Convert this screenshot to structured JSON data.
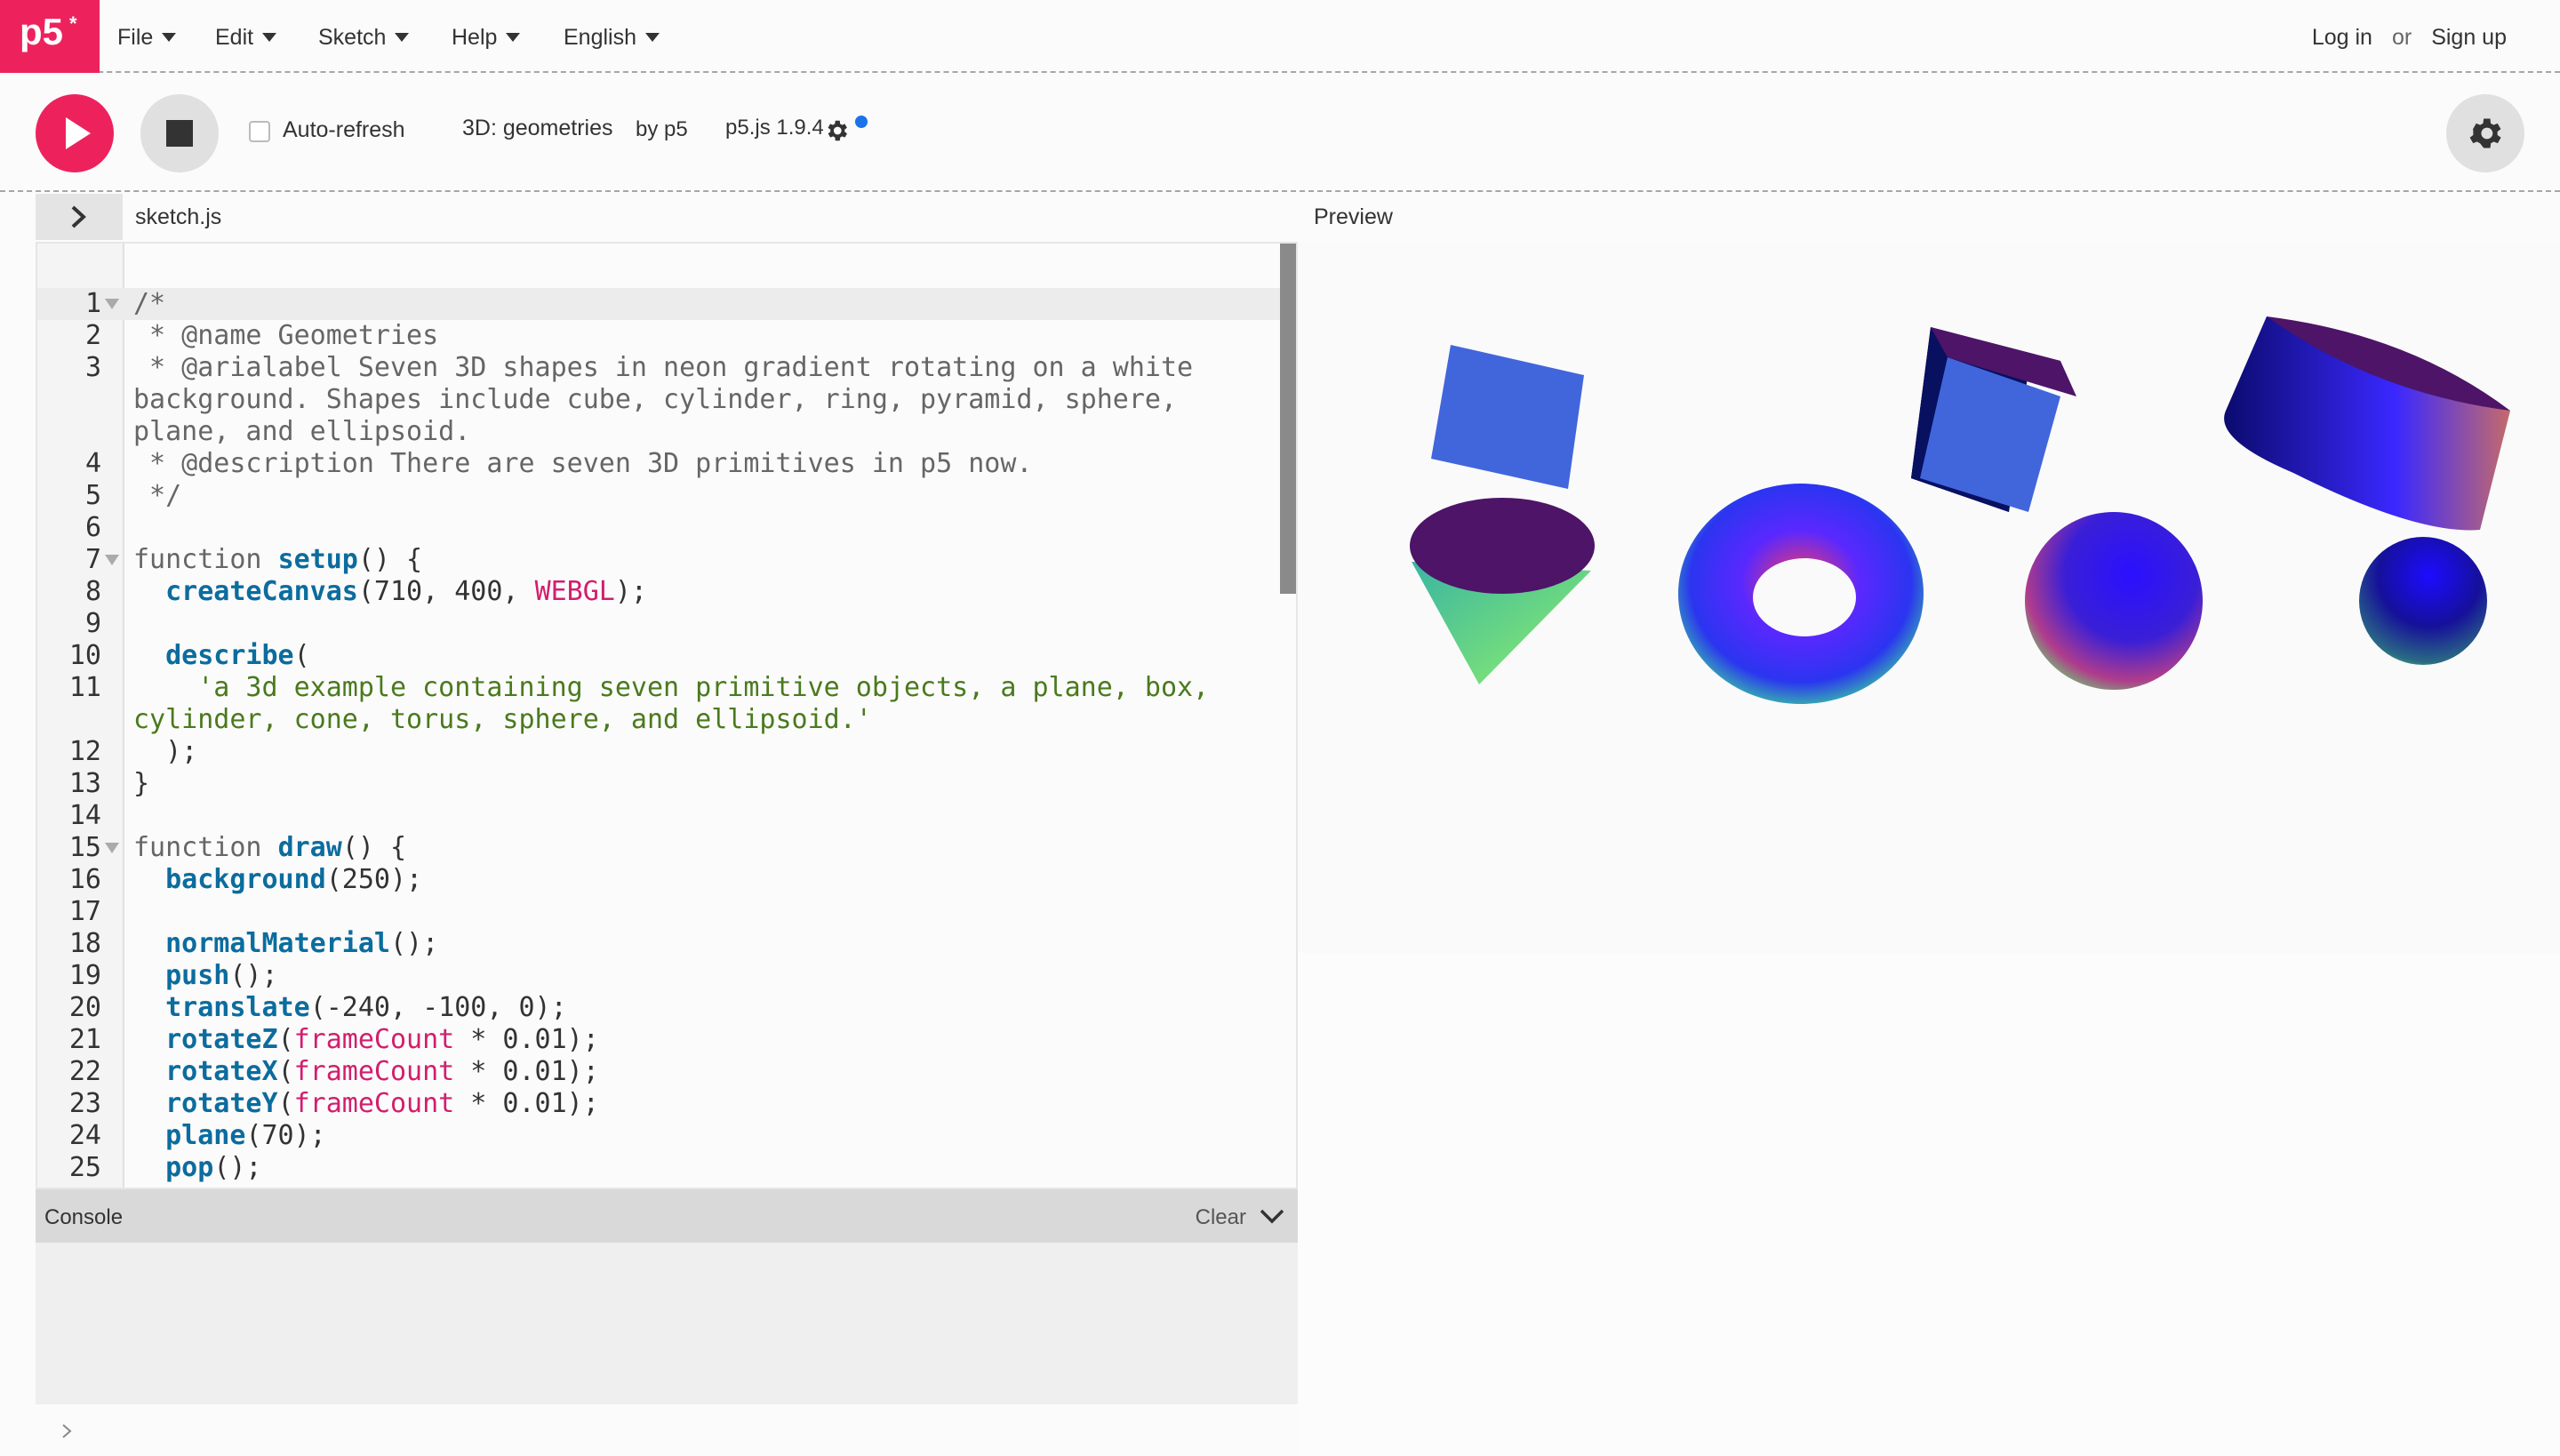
{
  "app": {
    "logo": "p5",
    "logo_sup": "*"
  },
  "nav": {
    "menus": [
      {
        "label": "File"
      },
      {
        "label": "Edit"
      },
      {
        "label": "Sketch"
      },
      {
        "label": "Help"
      },
      {
        "label": "English"
      }
    ],
    "login": "Log in",
    "or": "or",
    "signup": "Sign up"
  },
  "toolbar": {
    "auto_refresh_label": "Auto-refresh",
    "auto_refresh_checked": false,
    "sketch_name": "3D: geometries",
    "by": "by p5",
    "version": "p5.js 1.9.4"
  },
  "editor": {
    "filename": "sketch.js",
    "preview_label": "Preview",
    "lines": [
      {
        "n": "1",
        "fold": true,
        "text": "/*"
      },
      {
        "n": "2",
        "text": " * @name Geometries"
      },
      {
        "n": "3",
        "text": " * @arialabel Seven 3D shapes in neon gradient rotating on a white"
      },
      {
        "n": "",
        "text": "background. Shapes include cube, cylinder, ring, pyramid, sphere,"
      },
      {
        "n": "",
        "text": "plane, and ellipsoid."
      },
      {
        "n": "4",
        "text": " * @description There are seven 3D primitives in p5 now."
      },
      {
        "n": "5",
        "text": " */"
      },
      {
        "n": "6",
        "text": ""
      },
      {
        "n": "7",
        "fold": true,
        "text": "function setup() {"
      },
      {
        "n": "8",
        "text": "  createCanvas(710, 400, WEBGL);"
      },
      {
        "n": "9",
        "text": ""
      },
      {
        "n": "10",
        "text": "  describe("
      },
      {
        "n": "11",
        "text": "    'a 3d example containing seven primitive objects, a plane, box,"
      },
      {
        "n": "",
        "text": "cylinder, cone, torus, sphere, and ellipsoid.'"
      },
      {
        "n": "12",
        "text": "  );"
      },
      {
        "n": "13",
        "text": "}"
      },
      {
        "n": "14",
        "text": ""
      },
      {
        "n": "15",
        "fold": true,
        "text": "function draw() {"
      },
      {
        "n": "16",
        "text": "  background(250);"
      },
      {
        "n": "17",
        "text": ""
      },
      {
        "n": "18",
        "text": "  normalMaterial();"
      },
      {
        "n": "19",
        "text": "  push();"
      },
      {
        "n": "20",
        "text": "  translate(-240, -100, 0);"
      },
      {
        "n": "21",
        "text": "  rotateZ(frameCount * 0.01);"
      },
      {
        "n": "22",
        "text": "  rotateX(frameCount * 0.01);"
      },
      {
        "n": "23",
        "text": "  rotateY(frameCount * 0.01);"
      },
      {
        "n": "24",
        "text": "  plane(70);"
      },
      {
        "n": "25",
        "text": "  pop();"
      }
    ]
  },
  "console": {
    "title": "Console",
    "clear_label": "Clear"
  },
  "colors": {
    "brand": "#ed225d",
    "comment": "#666666",
    "function": "#0c6c9d",
    "constant": "#d21e6d",
    "string": "#4a7a1d"
  }
}
